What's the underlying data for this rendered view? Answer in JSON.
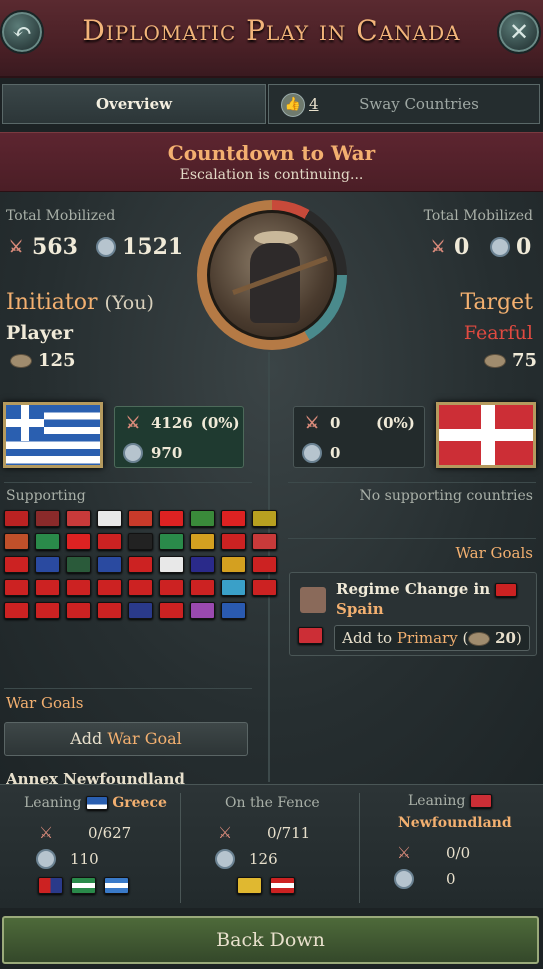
{
  "header": {
    "title": "Diplomatic Play in Canada",
    "back_icon": "↶",
    "close_icon": "✕"
  },
  "tabs": {
    "overview": "Overview",
    "sway_count": "4",
    "sway_label": "Sway Countries"
  },
  "banner": {
    "title": "Countdown to War",
    "subtitle": "Escalation is continuing..."
  },
  "initiator": {
    "mobilized_label": "Total Mobilized",
    "soldiers": "563",
    "conscripts": "1521",
    "role": "Initiator",
    "you": "(You)",
    "name": "Player",
    "maneuvers": "125",
    "flag": "greece",
    "mobil_soldiers": "4126",
    "mobil_pct": "(0%)",
    "mobil_conscripts": "970"
  },
  "target": {
    "mobilized_label": "Total Mobilized",
    "soldiers": "0",
    "conscripts": "0",
    "role": "Target",
    "attitude": "Fearful",
    "maneuvers": "75",
    "flag": "newfoundland",
    "mobil_soldiers": "0",
    "mobil_pct": "(0%)",
    "mobil_conscripts": "0",
    "no_supporters": "No supporting countries"
  },
  "supporting_label": "Supporting",
  "supporting_flags": [
    "#b22",
    "#8a2a2a",
    "#c83a3a",
    "#e8e8e8",
    "#c83a2a",
    "#d22",
    "#3a8a3a",
    "#d22",
    "#b8a020",
    "#c0502a",
    "#2a8a4a",
    "#d22",
    "#c22",
    "#222",
    "#2a8a4a",
    "#d4a020",
    "#c22",
    "#c83a3a",
    "#c22",
    "#2a4aa0",
    "#2a5a3a",
    "#2a4aa0",
    "#c22",
    "#e8e8e8",
    "#2a2a8a",
    "#d4a020",
    "#c22",
    "#c22",
    "#c22",
    "#c22",
    "#c22",
    "#c22",
    "#c22",
    "#c22",
    "#3aa0c8",
    "#c22",
    "#c22",
    "#c22",
    "#c22",
    "#c22",
    "#2a3a8a",
    "#c22",
    "#9a4ab0",
    "#2a5ab0"
  ],
  "war_goals": {
    "left_label": "War Goals",
    "add_prefix": "Add ",
    "add_accent": "War Goal",
    "right_label": "War Goals",
    "goal_title_1": "Regime Change in",
    "goal_title_2": "Spain",
    "add_to": "Add to ",
    "primary": "Primary",
    "cost_open": " (",
    "cost": "20",
    "cost_close": ")",
    "partial": "Annex   Newfoundland"
  },
  "leaning_greece": {
    "label": "Leaning",
    "name": "Greece",
    "soldiers": "0/627",
    "conscripts": "110"
  },
  "fence": {
    "label": "On the Fence",
    "soldiers": "0/711",
    "conscripts": "126"
  },
  "leaning_nf": {
    "label": "Leaning",
    "name": "Newfoundland",
    "soldiers": "0/0",
    "conscripts": "0"
  },
  "back_down": "Back Down"
}
